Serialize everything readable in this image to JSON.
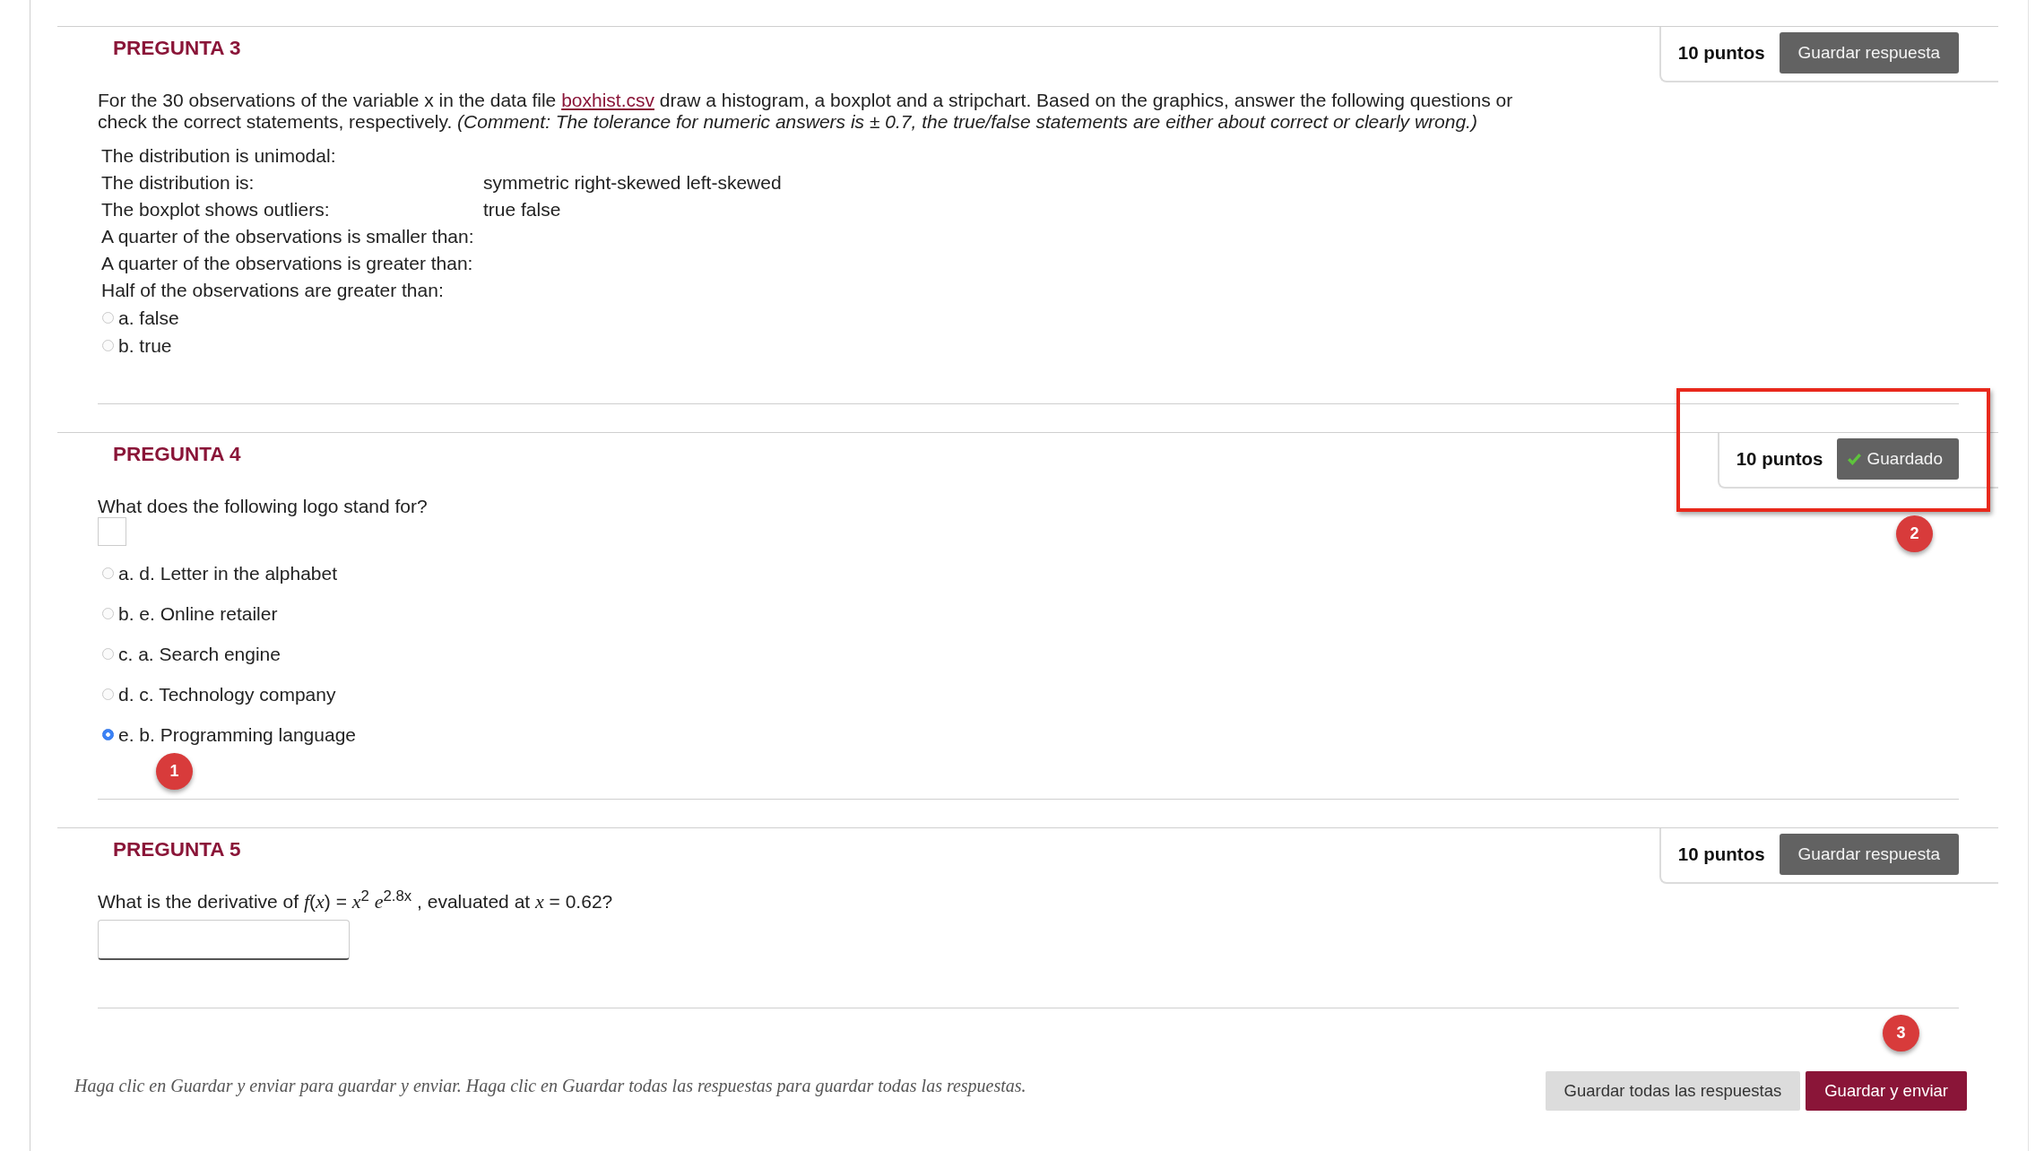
{
  "questions": [
    {
      "kind": "statements",
      "title": "PREGUNTA 3",
      "points": "10 puntos",
      "save_button": {
        "label": "Guardar respuesta",
        "saved": false
      },
      "prompt": [
        {
          "kind": "text",
          "text": "For the 30 observations of the variable x in the data file "
        },
        {
          "kind": "link",
          "text": "boxhist.csv"
        },
        {
          "kind": "text",
          "text": " draw a histogram, a boxplot and a stripchart. Based on the graphics, answer the following questions or check the correct statements, respectively. *(Comment: The tolerance for numeric answers is ± 0.7, the true/false statements are either about correct or clearly wrong.)*"
        }
      ],
      "statements": [
        {
          "label": "The distribution is unimodal:"
        },
        {
          "label": "The distribution is:",
          "value": "symmetric right-skewed left-skewed"
        },
        {
          "label": "The boxplot shows outliers:",
          "value": "true false"
        },
        {
          "label": "A quarter of the observations is smaller than:"
        },
        {
          "label": "A quarter of the observations is greater than:"
        },
        {
          "label": "Half of the observations are greater than:"
        }
      ],
      "choices": [
        {
          "label": "a. false",
          "selected": false
        },
        {
          "label": "b. true",
          "selected": false
        }
      ]
    },
    {
      "kind": "multiple_choice",
      "title": "PREGUNTA 4",
      "points": "10 puntos",
      "save_button": {
        "label": "Guardado",
        "saved": true,
        "highlighted": true,
        "callout": "2"
      },
      "prompt": [
        {
          "kind": "text",
          "text": "What does the following logo stand for?"
        }
      ],
      "image": {
        "kind": "placeholder"
      },
      "choices": [
        {
          "label": "a. d. Letter in the alphabet",
          "selected": false
        },
        {
          "label": "b. e. Online retailer",
          "selected": false
        },
        {
          "label": "c. a. Search engine",
          "selected": false
        },
        {
          "label": "d. c. Technology company",
          "selected": false
        },
        {
          "label": "e. b. Programming language",
          "selected": true
        }
      ],
      "callout": "1"
    },
    {
      "kind": "numeric",
      "title": "PREGUNTA 5",
      "points": "10 puntos",
      "save_button": {
        "label": "Guardar respuesta",
        "saved": false
      },
      "prompt": [
        {
          "kind": "text",
          "text": "What is the derivative of *f*(*x*) = *x*$^{2}$ *e*$^{2.8x}$ , evaluated at *x* = 0.62?"
        }
      ],
      "answer": {
        "kind": "text"
      }
    }
  ],
  "footer": {
    "instructions": "Haga clic en Guardar y enviar para guardar y enviar. Haga clic en Guardar todas las respuestas para guardar todas las respuestas.",
    "buttons": [
      {
        "label": "Guardar todas las respuestas",
        "kind": "secondary"
      },
      {
        "label": "Guardar y enviar",
        "kind": "primary"
      }
    ],
    "callout": "3"
  }
}
